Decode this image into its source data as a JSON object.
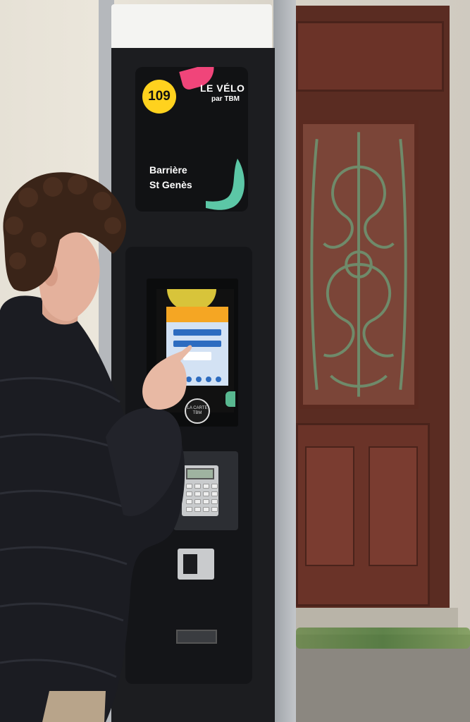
{
  "sign": {
    "station_number": "109",
    "brand_line1": "LE VÉLO",
    "brand_line2": "par TBM",
    "station_name_line1": "Barrière",
    "station_name_line2": "St Genès"
  },
  "kiosk": {
    "card_logo_line1": "LA CARTE",
    "card_logo_line2": "TBM"
  },
  "colors": {
    "badge_yellow": "#ffd21e",
    "accent_pink": "#f0457a",
    "accent_teal": "#5cc7a6",
    "screen_orange": "#f5a623",
    "kiosk_black": "#1c1d20"
  }
}
